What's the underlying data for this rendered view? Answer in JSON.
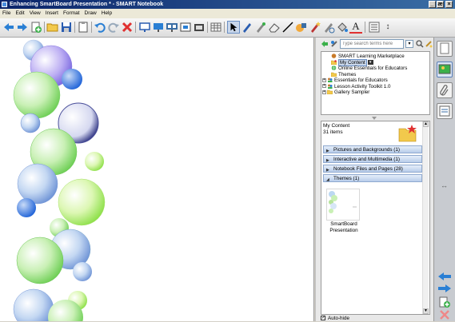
{
  "window": {
    "title": "Enhancing SmartBoard Presentation * - SMART Notebook",
    "minimize": "_",
    "restore": "æ",
    "close": "×"
  },
  "menu": [
    "File",
    "Edit",
    "View",
    "Insert",
    "Format",
    "Draw",
    "Help"
  ],
  "toolbar": {
    "icons": [
      "back-arrow",
      "forward-arrow",
      "new-page",
      "open",
      "save",
      "paste",
      "undo",
      "redo",
      "delete",
      "screen-shade",
      "full-screen",
      "dual-page",
      "capture",
      "document-camera",
      "table",
      "select",
      "pen",
      "creative-pen",
      "eraser",
      "line",
      "shapes",
      "magic-pen",
      "shape-recognition",
      "fill",
      "text",
      "properties",
      "more"
    ],
    "text_glyph": "A",
    "more_glyph": "↕"
  },
  "gallery": {
    "search_placeholder": "Type search terms here",
    "tree": [
      {
        "label": "SMART Learning Marketplace",
        "icon": "marketplace-icon",
        "indent": 1,
        "expander": ""
      },
      {
        "label": "My Content",
        "icon": "folder-icon",
        "indent": 1,
        "expander": "",
        "selected": true
      },
      {
        "label": "Online Essentials for Educators",
        "icon": "globe-icon",
        "indent": 1,
        "expander": ""
      },
      {
        "label": "Themes",
        "icon": "folder-icon",
        "indent": 1,
        "expander": ""
      },
      {
        "label": "Essentials for Educators",
        "icon": "people-icon",
        "indent": 0,
        "expander": "+"
      },
      {
        "label": "Lesson Activity Toolkit 1.0",
        "icon": "people-icon",
        "indent": 0,
        "expander": "+"
      },
      {
        "label": "Gallery Sampler",
        "icon": "folder-icon",
        "indent": 0,
        "expander": "+"
      }
    ],
    "content": {
      "title": "My Content",
      "count": "31 items",
      "categories": [
        {
          "label": "Pictures and Backgrounds (1)",
          "expanded": false
        },
        {
          "label": "Interactive and Multimedia (1)",
          "expanded": false
        },
        {
          "label": "Notebook Files and Pages (28)",
          "expanded": false
        },
        {
          "label": "Themes (1)",
          "expanded": true
        }
      ],
      "thumb_label_line1": "SmartBoard",
      "thumb_label_line2": "Presentation"
    },
    "auto_hide_label": "Auto-hide",
    "auto_hide_checked": true
  },
  "side_tabs": [
    "page-sorter",
    "gallery",
    "attachments",
    "properties"
  ],
  "side_tabs_collapse": "↔",
  "colors": {
    "titlebar": "#0a246a",
    "accent": "#3a6ea5",
    "category_fill": "#b8cdea"
  }
}
